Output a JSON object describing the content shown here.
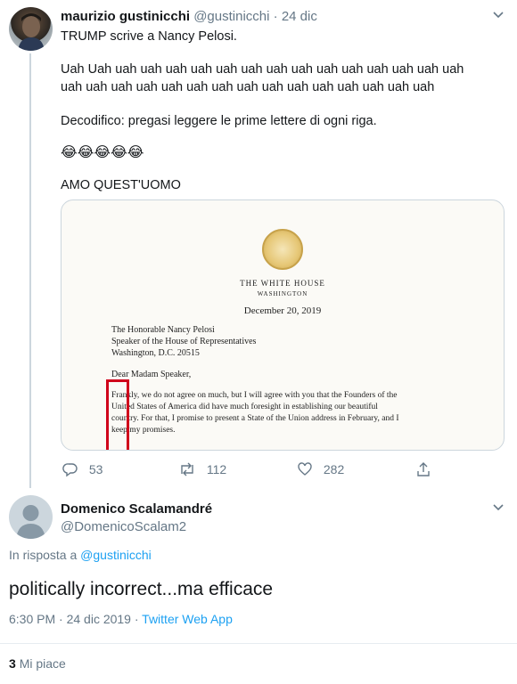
{
  "tweet": {
    "author_name": "maurizio gustinicchi",
    "handle": "@gustinicchi",
    "separator": "·",
    "date": "24 dic",
    "lines": [
      "TRUMP scrive a Nancy Pelosi.",
      "",
      "Uah Uah uah uah uah uah uah uah uah uah uah uah uah uah uah uah",
      "uah uah uah uah uah uah uah uah uah uah uah uah uah uah uah",
      "",
      "Decodifico: pregasi leggere le prime lettere di ogni riga.",
      "",
      "😂😂😂😂😂",
      "",
      "AMO QUEST'UOMO"
    ],
    "letter": {
      "header": "THE WHITE HOUSE",
      "subheader": "WASHINGTON",
      "date": "December 20, 2019",
      "address": [
        "The Honorable Nancy Pelosi",
        "Speaker of the House of Representatives",
        "Washington, D.C. 20515"
      ],
      "salutation": "Dear Madam Speaker,",
      "body": [
        "Frankly, we do not agree on much, but I will agree with you that the Founders of the",
        "United States of America did have much foresight in establishing our beautiful",
        "country. For that, I promise to present a State of the Union address in February, and I",
        "keep my promises."
      ]
    },
    "actions": {
      "replies": "53",
      "retweets": "112",
      "likes": "282"
    }
  },
  "reply": {
    "author_name": "Domenico Scalamandré",
    "handle": "@DomenicoScalam2",
    "in_reply_prefix": "In risposta a",
    "in_reply_handle": "@gustinicchi",
    "text": "politically incorrect...ma efficace",
    "time": "6:30 PM · 24 dic 2019 ·",
    "source": "Twitter Web App",
    "likes_count": "3",
    "likes_label": "Mi piace"
  },
  "colors": {
    "accent": "#1da1f2",
    "muted": "#657786",
    "highlight_box": "#d0021b"
  }
}
